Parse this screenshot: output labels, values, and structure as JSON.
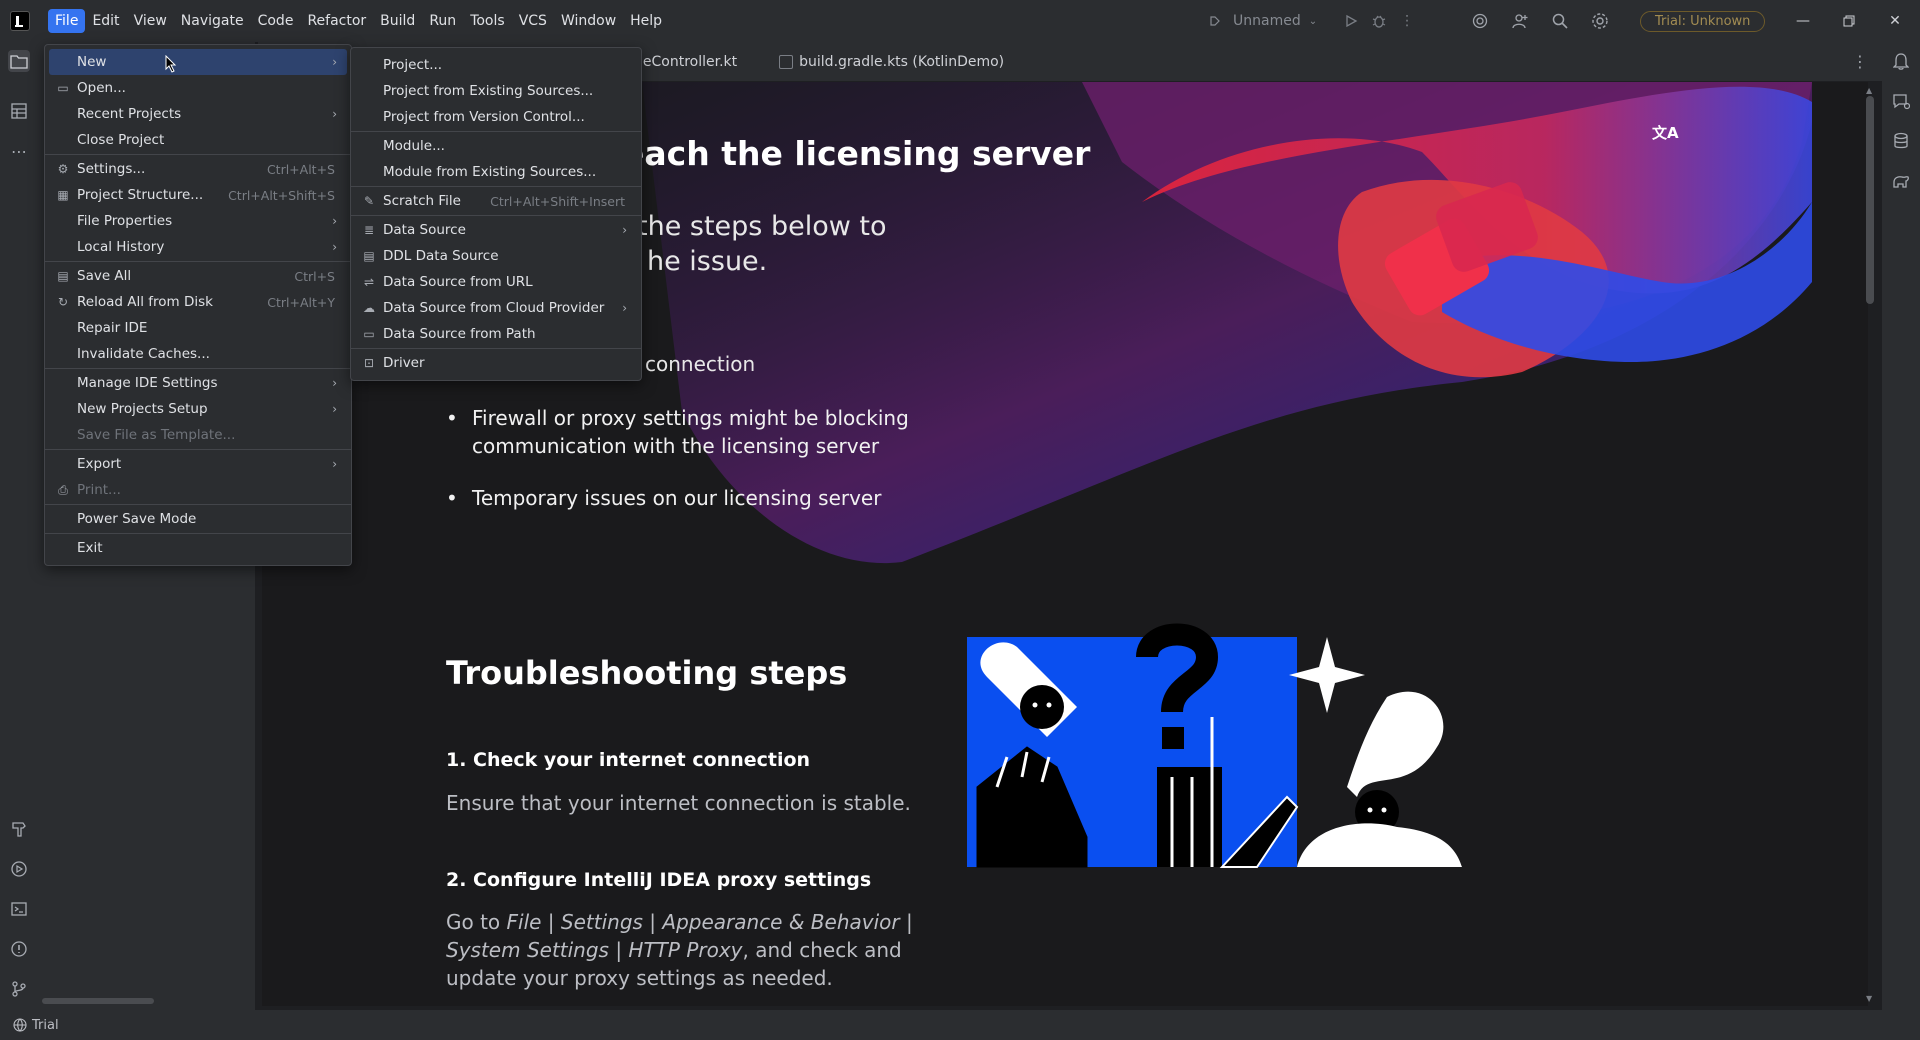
{
  "menubar": [
    "File",
    "Edit",
    "View",
    "Navigate",
    "Code",
    "Refactor",
    "Build",
    "Run",
    "Tools",
    "VCS",
    "Window",
    "Help"
  ],
  "titlebar": {
    "project_name": "Unnamed",
    "trial_badge": "Trial: Unknown"
  },
  "editor_tabs": [
    {
      "label": "geController.kt"
    },
    {
      "label": "build.gradle.kts (KotlinDemo)"
    }
  ],
  "file_menu": [
    {
      "label": "New",
      "shortcut": "",
      "submenu": true,
      "icon": "",
      "highlighted": true
    },
    {
      "label": "Open...",
      "shortcut": "",
      "submenu": false,
      "icon": "folder-icon"
    },
    {
      "label": "Recent Projects",
      "shortcut": "",
      "submenu": true,
      "icon": ""
    },
    {
      "label": "Close Project",
      "shortcut": "",
      "submenu": false,
      "icon": ""
    },
    {
      "label": "Settings...",
      "shortcut": "Ctrl+Alt+S",
      "submenu": false,
      "icon": "gear-icon"
    },
    {
      "label": "Project Structure...",
      "shortcut": "Ctrl+Alt+Shift+S",
      "submenu": false,
      "icon": "project-structure-icon"
    },
    {
      "label": "File Properties",
      "shortcut": "",
      "submenu": true,
      "icon": ""
    },
    {
      "label": "Local History",
      "shortcut": "",
      "submenu": true,
      "icon": ""
    },
    {
      "label": "Save All",
      "shortcut": "Ctrl+S",
      "submenu": false,
      "icon": "save-icon"
    },
    {
      "label": "Reload All from Disk",
      "shortcut": "Ctrl+Alt+Y",
      "submenu": false,
      "icon": "reload-icon"
    },
    {
      "label": "Repair IDE",
      "shortcut": "",
      "submenu": false,
      "icon": ""
    },
    {
      "label": "Invalidate Caches...",
      "shortcut": "",
      "submenu": false,
      "icon": ""
    },
    {
      "label": "Manage IDE Settings",
      "shortcut": "",
      "submenu": true,
      "icon": ""
    },
    {
      "label": "New Projects Setup",
      "shortcut": "",
      "submenu": true,
      "icon": ""
    },
    {
      "label": "Save File as Template...",
      "shortcut": "",
      "submenu": false,
      "icon": "",
      "disabled": true
    },
    {
      "label": "Export",
      "shortcut": "",
      "submenu": true,
      "icon": ""
    },
    {
      "label": "Print...",
      "shortcut": "",
      "submenu": false,
      "icon": "print-icon",
      "disabled": true
    },
    {
      "label": "Power Save Mode",
      "shortcut": "",
      "submenu": false,
      "icon": ""
    },
    {
      "label": "Exit",
      "shortcut": "",
      "submenu": false,
      "icon": ""
    }
  ],
  "new_submenu": [
    {
      "label": "Project...",
      "shortcut": "",
      "submenu": false,
      "icon": ""
    },
    {
      "label": "Project from Existing Sources...",
      "shortcut": "",
      "submenu": false,
      "icon": ""
    },
    {
      "label": "Project from Version Control...",
      "shortcut": "",
      "submenu": false,
      "icon": ""
    },
    {
      "label": "Module...",
      "shortcut": "",
      "submenu": false,
      "icon": ""
    },
    {
      "label": "Module from Existing Sources...",
      "shortcut": "",
      "submenu": false,
      "icon": ""
    },
    {
      "label": "Scratch File",
      "shortcut": "Ctrl+Alt+Shift+Insert",
      "submenu": false,
      "icon": "scratch-file-icon"
    },
    {
      "label": "Data Source",
      "shortcut": "",
      "submenu": true,
      "icon": "database-icon"
    },
    {
      "label": "DDL Data Source",
      "shortcut": "",
      "submenu": false,
      "icon": "ddl-icon"
    },
    {
      "label": "Data Source from URL",
      "shortcut": "",
      "submenu": false,
      "icon": "url-icon"
    },
    {
      "label": "Data Source from Cloud Provider",
      "shortcut": "",
      "submenu": true,
      "icon": "cloud-icon"
    },
    {
      "label": "Data Source from Path",
      "shortcut": "",
      "submenu": false,
      "icon": "folder-icon"
    },
    {
      "label": "Driver",
      "shortcut": "",
      "submenu": false,
      "icon": "driver-icon"
    }
  ],
  "page": {
    "title_partial": "each the licensing server",
    "subtitle_line1": "the steps below to",
    "subtitle_line2": "he issue.",
    "bullet_partial": "connection",
    "bullets": [
      "Firewall or proxy settings might be blocking communication with the licensing server",
      "Temporary issues on our licensing server"
    ],
    "troubleshooting_title": "Troubleshooting steps",
    "step1_title": "1. Check your internet connection",
    "step1_text": "Ensure that your internet connection is stable.",
    "step2_title": "2. Configure IntelliJ IDEA proxy settings",
    "step2_text_prefix": "Go to ",
    "step2_text_italic": "File | Settings | Appearance & Behavior | System Settings | HTTP Proxy",
    "step2_text_suffix": ", and check and update your proxy settings as needed."
  },
  "statusbar": {
    "label": "Trial"
  },
  "colors": {
    "accent": "#3574f0",
    "menu_highlight": "#2e436e",
    "illustration_blue": "#0a4ff0",
    "illustration_red": "#e8253b"
  }
}
